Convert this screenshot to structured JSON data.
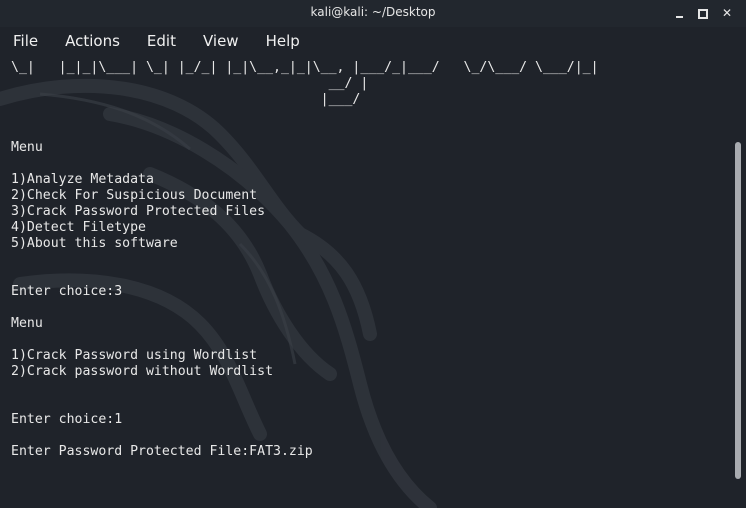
{
  "window": {
    "title": "kali@kali: ~/Desktop"
  },
  "menubar": {
    "items": [
      "File",
      "Actions",
      "Edit",
      "View",
      "Help"
    ]
  },
  "terminal": {
    "lines": [
      "\\_|   |_|_|\\___| \\_| |_/_| |_|\\__,_|_|\\__, |___/_|___/   \\_/\\___/ \\___/|_|",
      "                                        __/ |",
      "                                       |___/",
      "",
      "",
      "Menu",
      "",
      "1)Analyze Metadata",
      "2)Check For Suspicious Document",
      "3)Crack Password Protected Files",
      "4)Detect Filetype",
      "5)About this software",
      "",
      "",
      "Enter choice:3",
      "",
      "Menu",
      "",
      "1)Crack Password using Wordlist",
      "2)Crack password without Wordlist",
      "",
      "",
      "Enter choice:1",
      "",
      "Enter Password Protected File:FAT3.zip",
      "",
      ""
    ]
  }
}
